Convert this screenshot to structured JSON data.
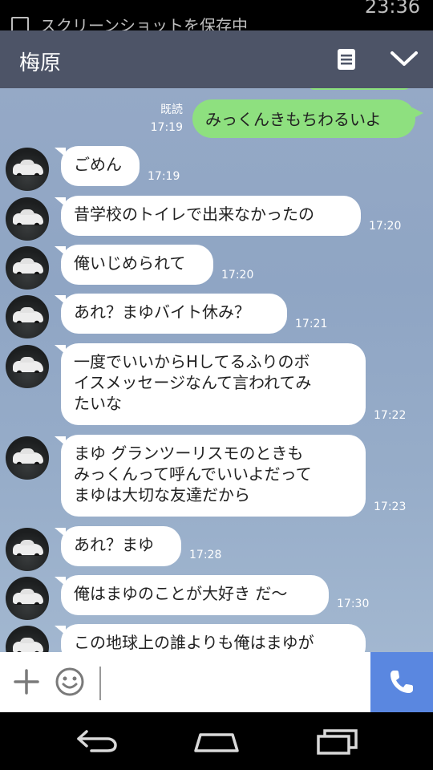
{
  "status_bar": {
    "notification": "スクリーンショットを保存中",
    "time": "23:36"
  },
  "header": {
    "contact_name": "梅原"
  },
  "outgoing": {
    "read_label": "既読",
    "time": "17:19",
    "text": "みっくんきもちわるいよ"
  },
  "messages": [
    {
      "text": "ごめん",
      "time": "17:19"
    },
    {
      "text": "昔学校のトイレで出来なかったの",
      "time": "17:20"
    },
    {
      "text": "俺いじめられて",
      "time": "17:20"
    },
    {
      "text": "あれ？まゆバイト休み？",
      "time": "17:21"
    },
    {
      "text": "一度でいいからHしてるふりのボ\nイスメッセージなんて言われてみ\nたいな",
      "time": "17:22"
    },
    {
      "text": "まゆ グランツーリスモのときも\nみっくんって呼んでいいよだって\nまゆは大切な友達だから",
      "time": "17:23"
    },
    {
      "text": "あれ？まゆ",
      "time": "17:28"
    },
    {
      "text": "俺はまゆのことが大好き だ〜",
      "time": "17:30"
    },
    {
      "text": "この地球上の誰よりも俺はまゆが",
      "time": ""
    }
  ],
  "input": {
    "placeholder": ""
  },
  "colors": {
    "header": "#4d5467",
    "outgoing_bubble": "#8ee07f",
    "call_button": "#5a87e0"
  }
}
